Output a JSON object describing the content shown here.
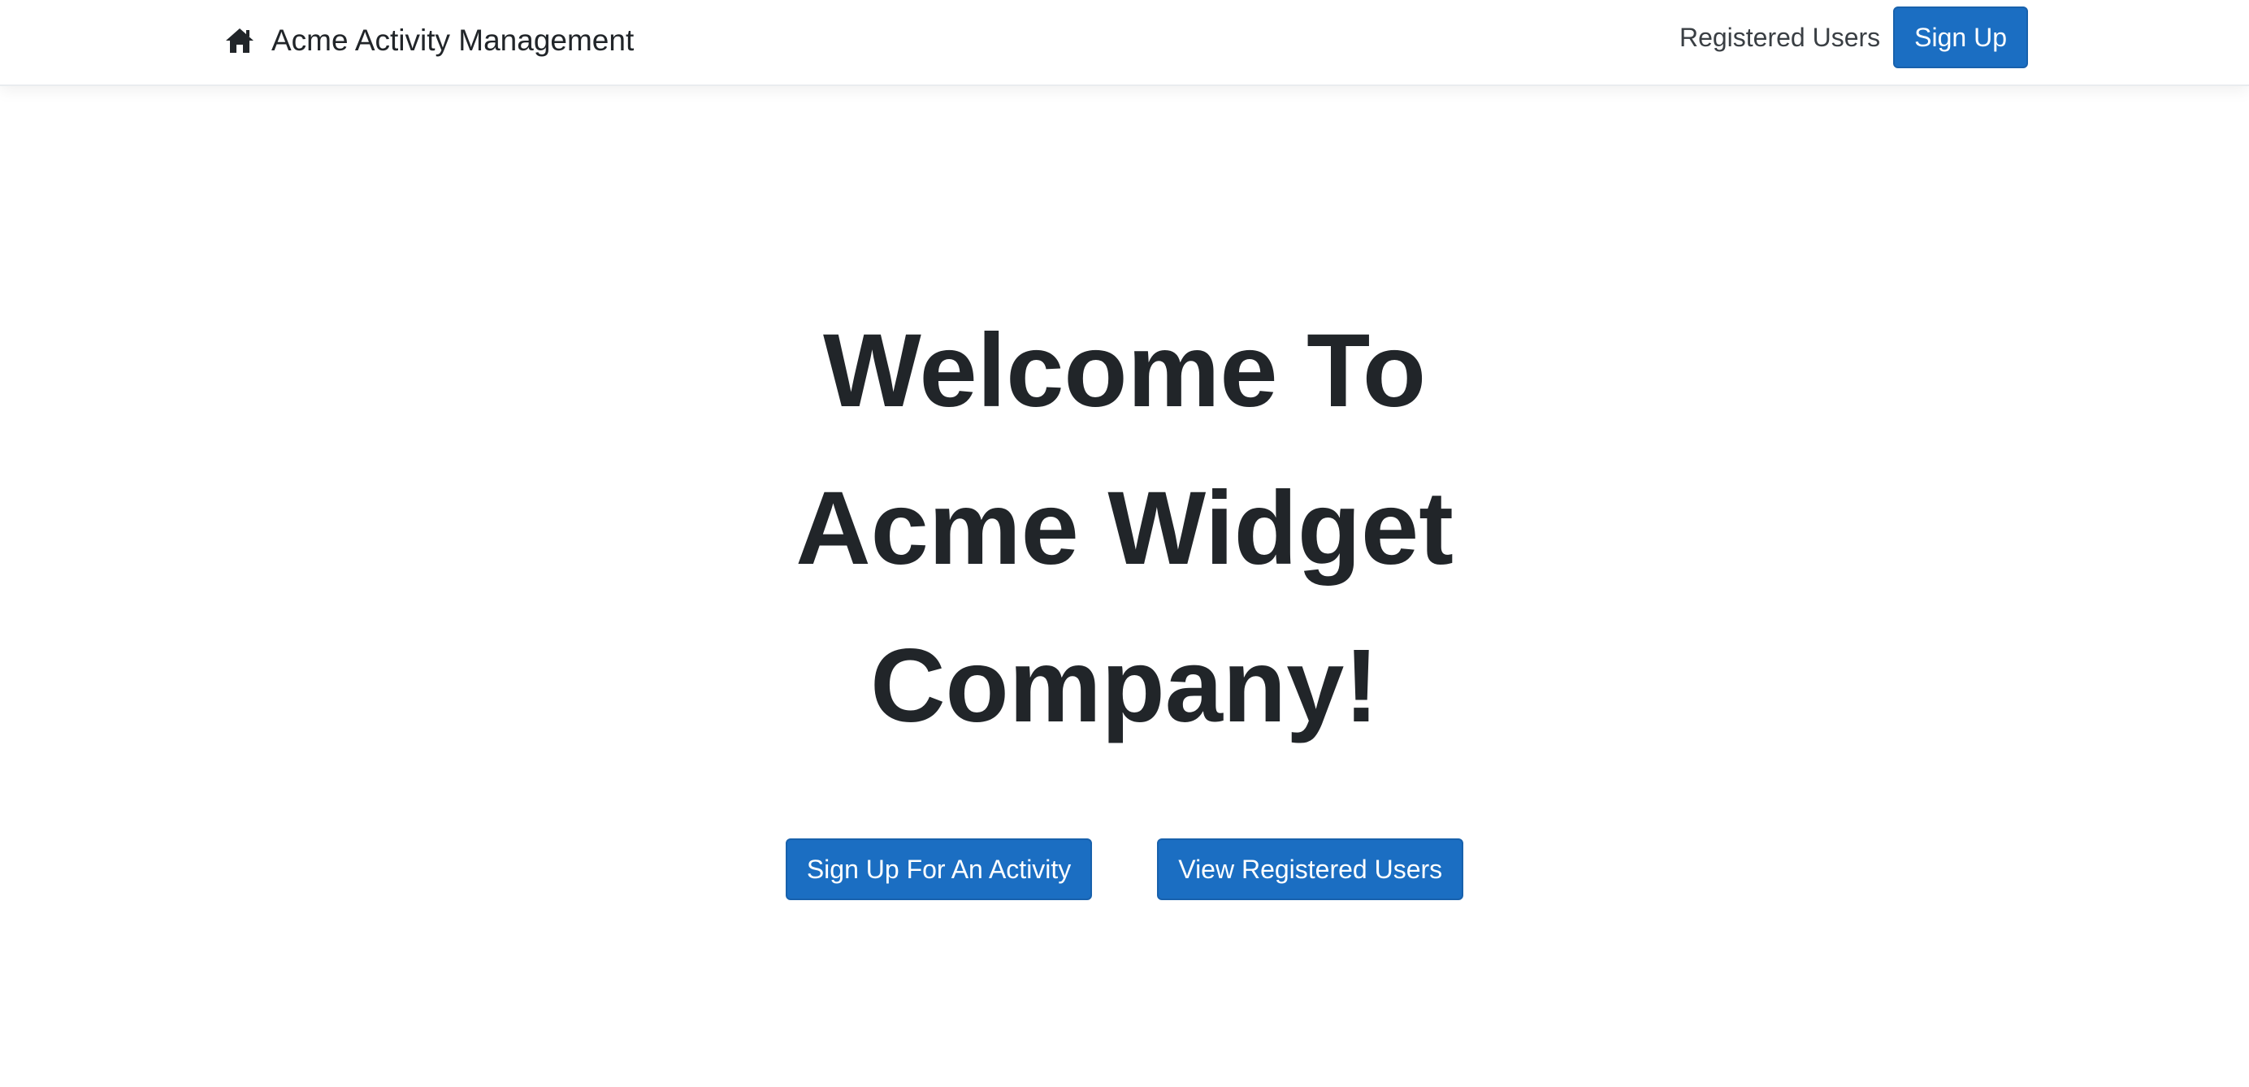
{
  "navbar": {
    "brand_icon": "home-icon",
    "brand_text": "Acme Activity Management",
    "links": {
      "registered_users": "Registered Users"
    },
    "signup_button": "Sign Up"
  },
  "hero": {
    "title": "Welcome To Acme Widget Company!"
  },
  "actions": {
    "signup_activity": "Sign Up For An Activity",
    "view_users": "View Registered Users"
  },
  "colors": {
    "primary": "#1b6ec2",
    "primary_border": "#1861ac",
    "text": "#212529"
  }
}
